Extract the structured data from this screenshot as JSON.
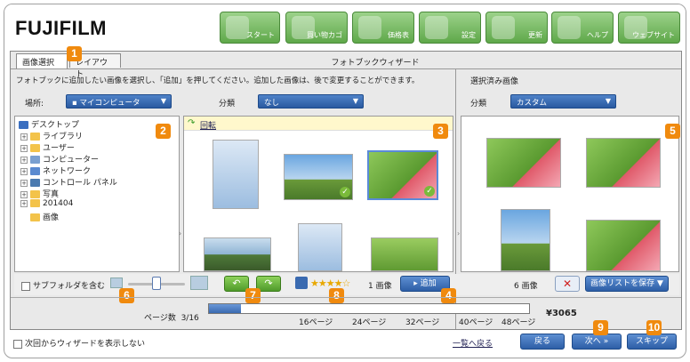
{
  "brand": {
    "logo_text": "FUJIFILM"
  },
  "nav": [
    {
      "label": "スタート",
      "icon": "home-icon"
    },
    {
      "label": "買い物カゴ",
      "icon": "cart-icon"
    },
    {
      "label": "価格表",
      "icon": "price-list-icon"
    },
    {
      "label": "設定",
      "icon": "gear-icon"
    },
    {
      "label": "更新",
      "icon": "refresh-icon"
    },
    {
      "label": "ヘルプ",
      "icon": "help-icon"
    },
    {
      "label": "ウェブサイト",
      "icon": "globe-icon"
    }
  ],
  "tabs": [
    {
      "label": "画像選択"
    },
    {
      "label": "レイアウト"
    }
  ],
  "wizard_title": "フォトブックウィザード",
  "instruction": "フォトブックに追加したい画像を選択し、「追加」を押してください。追加した画像は、後で変更することができます。",
  "left": {
    "location_label": "場所:",
    "location_value": "マイコンピュータ",
    "category_label": "分類",
    "category_value": "なし",
    "tree": [
      {
        "label": "デスクトップ"
      },
      {
        "label": "ライブラリ"
      },
      {
        "label": "ユーザー"
      },
      {
        "label": "コンピューター"
      },
      {
        "label": "ネットワーク"
      },
      {
        "label": "コントロール パネル"
      },
      {
        "label": "写真"
      },
      {
        "label": "201404"
      },
      {
        "label": "画像"
      }
    ],
    "rotate_label": "回転",
    "subfolder_label": "サブフォルダを含む",
    "image_count": "1 画像",
    "add_label": "追加"
  },
  "right": {
    "header": "選択済み画像",
    "category_label": "分類",
    "category_value": "カスタム",
    "image_count": "6 画像",
    "save_list_label": "画像リストを保存"
  },
  "pages": {
    "label": "ページ数",
    "current": "3/16",
    "ticks": [
      "16ページ",
      "24ページ",
      "32ページ",
      "40ページ",
      "48ページ"
    ],
    "progress": 0.1,
    "price": "¥3065"
  },
  "footer": {
    "no_show_label": "次回からウィザードを表示しない",
    "back_to_list": "一覧へ戻る",
    "back": "戻る",
    "next": "次へ",
    "skip": "スキップ"
  },
  "badges": [
    "1",
    "2",
    "3",
    "4",
    "5",
    "6",
    "7",
    "8",
    "9",
    "10"
  ],
  "colors": {
    "nav_green": "#5fa84a",
    "button_blue": "#2d5ea6",
    "badge_orange": "#f08a0e"
  }
}
